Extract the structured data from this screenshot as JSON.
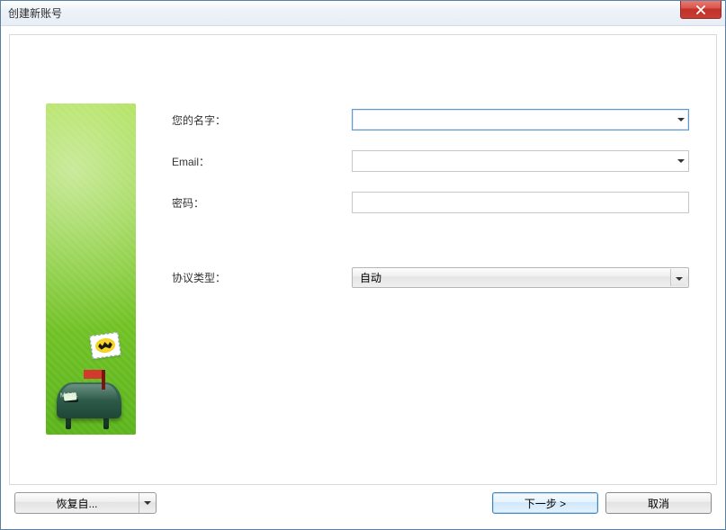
{
  "window": {
    "title": "创建新账号"
  },
  "form": {
    "name": {
      "label": "您的名字：",
      "value": ""
    },
    "email": {
      "label": "Email：",
      "value": ""
    },
    "password": {
      "label": "密码：",
      "value": ""
    },
    "protocol": {
      "label": "协议类型：",
      "selected": "自动"
    }
  },
  "illustration": {
    "mailbox_label": "MAIL"
  },
  "footer": {
    "restore": "恢复自...",
    "next": "下一步   >",
    "cancel": "取消"
  }
}
